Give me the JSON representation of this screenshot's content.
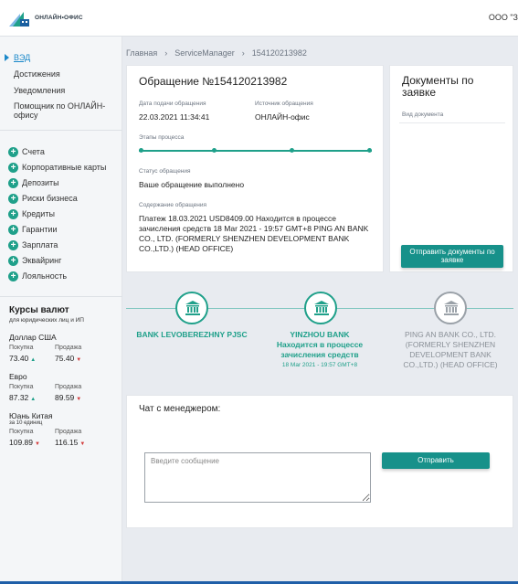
{
  "header": {
    "logo_text": "ОНЛАЙН•ОФИС",
    "company": "ООО \"З"
  },
  "sidebar": {
    "top_items": [
      {
        "label": "ВЭД"
      },
      {
        "label": "Достижения"
      },
      {
        "label": "Уведомления"
      },
      {
        "label": "Помощник по ОНЛАЙН-офису"
      }
    ],
    "products": [
      {
        "label": "Счета"
      },
      {
        "label": "Корпоративные карты"
      },
      {
        "label": "Депозиты"
      },
      {
        "label": "Риски бизнеса"
      },
      {
        "label": "Кредиты"
      },
      {
        "label": "Гарантии"
      },
      {
        "label": "Зарплата"
      },
      {
        "label": "Эквайринг"
      },
      {
        "label": "Лояльность"
      }
    ],
    "rates": {
      "title": "Курсы валют",
      "subtitle": "для юридических лиц и ИП",
      "buy_label": "Покупка",
      "sell_label": "Продажа",
      "currencies": [
        {
          "name": "Доллар США",
          "note": "",
          "buy": "73.40",
          "sell": "75.40",
          "buy_trend": "up",
          "sell_trend": "down"
        },
        {
          "name": "Евро",
          "note": "",
          "buy": "87.32",
          "sell": "89.59",
          "buy_trend": "up",
          "sell_trend": "down"
        },
        {
          "name": "Юань Китая",
          "note": "за 10 единиц",
          "buy": "109.89",
          "sell": "116.15",
          "buy_trend": "down",
          "sell_trend": "down"
        }
      ]
    }
  },
  "breadcrumb": [
    "Главная",
    "ServiceManager",
    "154120213982"
  ],
  "request": {
    "title": "Обращение №154120213982",
    "date_label": "Дата подачи обращения",
    "date_value": "22.03.2021 11:34:41",
    "source_label": "Источник обращения",
    "source_value": "ОНЛАЙН-офис",
    "stages_label": "Этапы процесса",
    "stages_progress": 1.0,
    "status_label": "Статус обращения",
    "status_value": "Ваше обращение выполнено",
    "content_label": "Содержание обращения",
    "content_value": "Платеж 18.03.2021 USD8409.00 Находится в процессе зачисления средств 18 Mar 2021 - 19:57 GMT+8 PING AN BANK CO., LTD. (FORMERLY SHENZHEN DEVELOPMENT BANK CO.,LTD.) (HEAD OFFICE)"
  },
  "docs": {
    "title": "Документы по заявке",
    "type_label": "Вид документа",
    "send_button": "Отправить документы по заявке"
  },
  "timeline": {
    "steps": [
      {
        "name": "BANK LEVOBEREZHNY PJSC",
        "status": "",
        "date": "",
        "state": "done"
      },
      {
        "name": "YINZHOU BANK",
        "status": "Находится в процессе зачисления средств",
        "date": "18 Mar 2021 - 19:57 GMT+8",
        "state": "current"
      },
      {
        "name": "PING AN BANK CO., LTD. (FORMERLY SHENZHEN DEVELOPMENT BANK CO.,LTD.) (HEAD OFFICE)",
        "status": "",
        "date": "",
        "state": "pending"
      }
    ],
    "colors": {
      "active": "#1fa08a",
      "inactive": "#9aa1a8"
    }
  },
  "chat": {
    "title": "Чат с менеджером:",
    "placeholder": "Введите сообщение",
    "send_button": "Отправить"
  },
  "colors": {
    "accent": "#17918a",
    "link": "#1a88c9",
    "trend_up": "#1fa08a",
    "trend_down": "#d23a3a"
  },
  "icons": {
    "logo": "building-arrow-logo",
    "bank": "bank-building-icon",
    "add": "plus-circle-icon"
  }
}
